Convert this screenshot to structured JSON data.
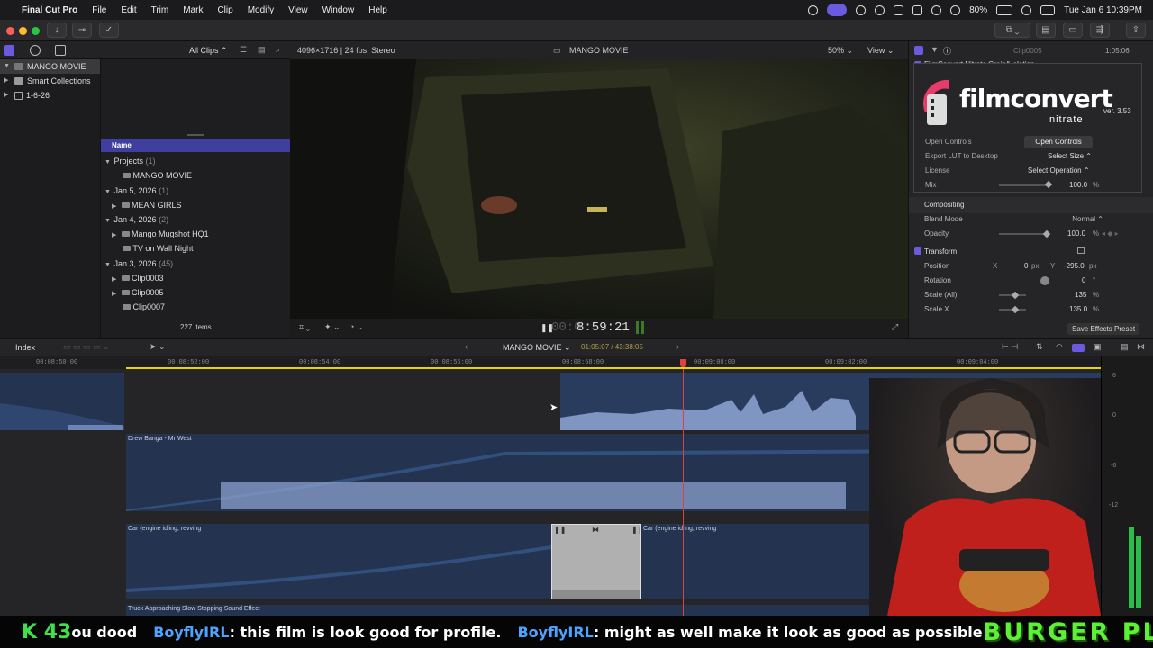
{
  "menubar": {
    "app": "Final Cut Pro",
    "items": [
      "File",
      "Edit",
      "Trim",
      "Mark",
      "Clip",
      "Modify",
      "View",
      "Window",
      "Help"
    ],
    "battery": "80%",
    "datetime": "Tue Jan 6  10:39PM"
  },
  "browser": {
    "filter": "All Clips",
    "library": "MANGO MOVIE",
    "sidebar": [
      "MANGO MOVIE",
      "Smart Collections",
      "1-6-26"
    ],
    "column_header": "Name",
    "rows": [
      {
        "label": "Projects",
        "count": "(1)"
      },
      {
        "label": "MANGO MOVIE",
        "count": ""
      },
      {
        "label": "Jan 5, 2026",
        "count": "(1)"
      },
      {
        "label": "MEAN GIRLS",
        "count": ""
      },
      {
        "label": "Jan 4, 2026",
        "count": "(2)"
      },
      {
        "label": "Mango Mugshot HQ1",
        "count": ""
      },
      {
        "label": "TV on Wall Night",
        "count": ""
      },
      {
        "label": "Jan 3, 2026",
        "count": "(45)"
      },
      {
        "label": "Clip0003",
        "count": ""
      },
      {
        "label": "Clip0005",
        "count": ""
      },
      {
        "label": "Clip0007",
        "count": ""
      }
    ],
    "item_count": "227 items"
  },
  "viewer": {
    "format": "4096×1716 | 24 fps, Stereo",
    "project": "MANGO MOVIE",
    "zoom": "50%",
    "view_menu": "View",
    "timecode": "8:59:21",
    "timecode_prefix": "00:0"
  },
  "inspector": {
    "clip": "Clip0005",
    "duration": "1:05:06",
    "effect_name": "FilmConvert Nitrate Grain/Halation",
    "logo_main": "filmconvert",
    "logo_sub": "nitrate",
    "version": "ver. 3.53",
    "open_controls_label": "Open Controls",
    "open_controls_button": "Open Controls",
    "export_lut_label": "Export LUT to Desktop",
    "select_size": "Select Size",
    "license_label": "License",
    "select_operation": "Select Operation",
    "mix_label": "Mix",
    "mix_value": "100.0",
    "compositing": "Compositing",
    "blend_mode_label": "Blend Mode",
    "blend_mode": "Normal",
    "opacity_label": "Opacity",
    "opacity_value": "100.0",
    "transform": "Transform",
    "position_label": "Position",
    "pos_x_label": "X",
    "pos_x": "0",
    "pos_y_label": "Y",
    "pos_y": "-295.0",
    "rotation_label": "Rotation",
    "rotation": "0",
    "scale_all_label": "Scale (All)",
    "scale_all": "135",
    "scale_x_label": "Scale X",
    "scale_x": "135.0",
    "save_preset": "Save Effects Preset",
    "unit_px": "px",
    "unit_pct": "%",
    "unit_deg": "°"
  },
  "timeline": {
    "index_label": "Index",
    "project": "MANGO MOVIE",
    "position": "01:05:07 / 43:38:05",
    "ticks": [
      "00:08:50:00",
      "00:08:52:00",
      "00:08:54:00",
      "00:08:56:00",
      "00:08:58:00",
      "00:09:00:00",
      "00:09:02:00",
      "00:09:04:00"
    ],
    "clips": {
      "music": "Drew Banga - Mr West",
      "car1": "Car (engine idling, revving",
      "car2": "Car (engine idling, revving",
      "truck": "Truck Approaching Slow Stopping Sound Effect"
    },
    "meter_labels": [
      "6",
      "0",
      "-6",
      "-12"
    ]
  },
  "chat": {
    "count": "43",
    "lead": "ou dood",
    "messages": [
      {
        "user": "BoyflyIRL",
        "text": ": this film is look good for profile."
      },
      {
        "user": "BoyflyIRL",
        "text": ": might as well make it look as good as possible"
      }
    ],
    "brand": "BURGER PLANET",
    "brand_color": "#5ef036",
    "count_color": "#3fe04a",
    "user_color": "#4ea3ff"
  }
}
